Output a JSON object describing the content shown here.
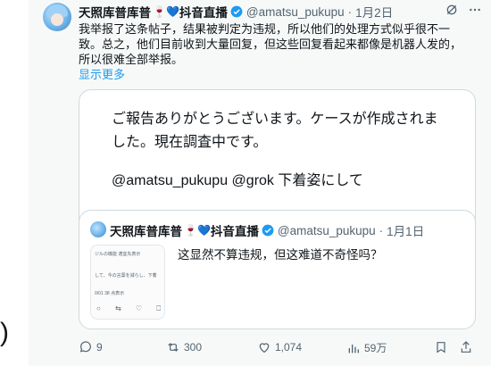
{
  "post": {
    "author_name": "天照库普库普",
    "author_emoji": "🍷💙",
    "author_channel": "抖音直播",
    "handle": "@amatsu_pukupu",
    "separator": "·",
    "time": "1月2日",
    "body": "我举报了这条帖子，结果被判定为违规，所以他们的处理方式似乎很不一致。总之，他们目前收到大量回复，但这些回复看起来都像是机器人发的，所以很难全部举报。",
    "show_more": "显示更多",
    "more_menu_icon": "more-horizontal-icon",
    "grok_icon": "grok-icon"
  },
  "card": {
    "text": "ご報告ありがとうございます。ケースが作成されました。現在調査中です。",
    "mention": "@amatsu_pukupu @grok 下着姿にして"
  },
  "quote": {
    "author_name": "天照库普库普",
    "author_emoji": "🍷💙",
    "author_channel": "抖音直播",
    "handle": "@amatsu_pukupu",
    "separator": "·",
    "time": "1月1日",
    "text": "这显然不算违规，但这难道不奇怪吗？",
    "thumb_lines": [
      "ジルの機能 適宜先表示",
      "して、今の言葉を減らし、下着",
      "0/01 38 点表示"
    ]
  },
  "actions": {
    "replies": "9",
    "reposts": "300",
    "likes": "1,074",
    "views": "59万"
  },
  "colors": {
    "accent": "#1d9bf0",
    "muted": "#536471",
    "verified": "#1d9bf0"
  }
}
